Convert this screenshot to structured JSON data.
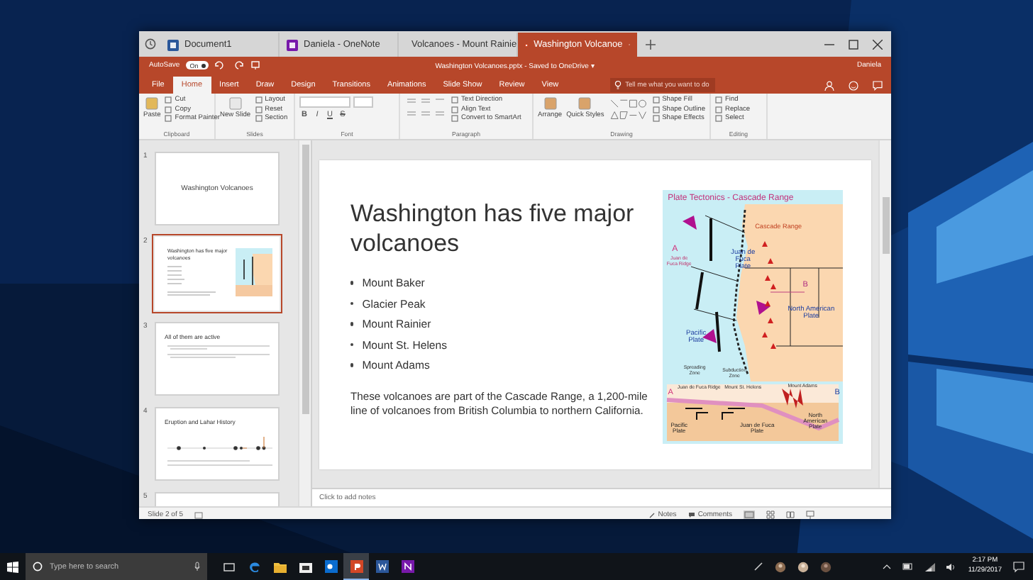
{
  "browser_tabs": [
    {
      "label": "Document1",
      "kind": "word",
      "selected": false
    },
    {
      "label": "Daniela - OneNote",
      "kind": "onenote",
      "selected": false
    },
    {
      "label": "Volcanoes - Mount Rainie",
      "kind": "browser",
      "selected": false
    },
    {
      "label": "Washington Volcanoe",
      "kind": "powerpoint",
      "selected": true
    }
  ],
  "title_bar": {
    "autosave_label": "AutoSave",
    "autosave_on": true,
    "autosave_state": "On",
    "document": "Washington Volcanoes.pptx - Saved to OneDrive ▾",
    "user": "Daniela"
  },
  "ribbon_tabs": [
    {
      "label": "File",
      "selected": false
    },
    {
      "label": "Home",
      "selected": true
    },
    {
      "label": "Insert",
      "selected": false
    },
    {
      "label": "Draw",
      "selected": false
    },
    {
      "label": "Design",
      "selected": false
    },
    {
      "label": "Transitions",
      "selected": false
    },
    {
      "label": "Animations",
      "selected": false
    },
    {
      "label": "Slide Show",
      "selected": false
    },
    {
      "label": "Review",
      "selected": false
    },
    {
      "label": "View",
      "selected": false
    }
  ],
  "tell_me": {
    "placeholder": "Tell me what you want to do"
  },
  "ribbon_groups": [
    {
      "kind": "clipboard",
      "label": "Clipboard",
      "large": [
        "Paste"
      ],
      "small": [
        "Cut",
        "Copy",
        "Format Painter"
      ]
    },
    {
      "kind": "slides",
      "label": "Slides",
      "large": [
        "New Slide"
      ],
      "small": [
        "Layout",
        "Reset",
        "Section"
      ]
    },
    {
      "kind": "font",
      "label": "Font",
      "format_buttons": [
        "B",
        "I",
        "U",
        "S"
      ]
    },
    {
      "kind": "paragraph",
      "label": "Paragraph",
      "small": [
        "Text Direction",
        "Align Text",
        "Convert to SmartArt"
      ]
    },
    {
      "kind": "drawing",
      "label": "Drawing",
      "large": [
        "Arrange",
        "Quick Styles"
      ],
      "small": [
        "Shape Fill",
        "Shape Outline",
        "Shape Effects"
      ]
    },
    {
      "kind": "editing",
      "label": "Editing",
      "small": [
        "Find",
        "Replace",
        "Select"
      ]
    }
  ],
  "thumbnails": [
    {
      "number": "1",
      "kind": "title",
      "title": "Washington Volcanoes",
      "selected": false
    },
    {
      "number": "2",
      "kind": "content_image",
      "title": "Washington has five major volcanoes",
      "selected": true
    },
    {
      "number": "3",
      "kind": "bullets",
      "title": "All of them are active",
      "selected": false
    },
    {
      "number": "4",
      "kind": "timeline",
      "title": "Eruption and Lahar History",
      "selected": false
    },
    {
      "number": "5",
      "kind": "partial",
      "selected": false
    }
  ],
  "slide": {
    "title": "Washington has five major volcanoes",
    "bullets": [
      "Mount Baker",
      "Glacier Peak",
      "Mount Rainier",
      "Mount St. Helens",
      "Mount Adams"
    ],
    "body": "These volcanoes are part of the Cascade Range, a 1,200-mile line of volcanoes from British Columbia to northern California.",
    "figure": {
      "title": "Plate Tectonics - Cascade Range",
      "labels": [
        "Cascade Range",
        "A",
        "Juan de Fuca Ridge",
        "Juan de Fuca Plate",
        "B",
        "North American Plate",
        "Pacific Plate",
        "Spreading Zone",
        "Subduction Zone",
        "A",
        "Juan de Fuca Ridge",
        "Mount St. Helens",
        "Mount Adams",
        "B",
        "Pacific Plate",
        "Juan de Fuca Plate",
        "North American Plate"
      ]
    }
  },
  "notes": {
    "placeholder": "Click to add notes"
  },
  "status_bar": {
    "slide_count": "Slide 2 of 5",
    "notes": "Notes",
    "comments": "Comments"
  },
  "taskbar": {
    "search_placeholder": "Type here to search",
    "apps": [
      {
        "kind": "task-view",
        "active": false
      },
      {
        "kind": "edge",
        "active": false
      },
      {
        "kind": "files",
        "active": false
      },
      {
        "kind": "store",
        "active": false
      },
      {
        "kind": "outlook",
        "active": false
      },
      {
        "kind": "powerpoint",
        "active": true
      },
      {
        "kind": "word",
        "active": false
      },
      {
        "kind": "onenote",
        "active": false
      }
    ],
    "time": "2:17 PM",
    "date": "11/29/2017"
  }
}
